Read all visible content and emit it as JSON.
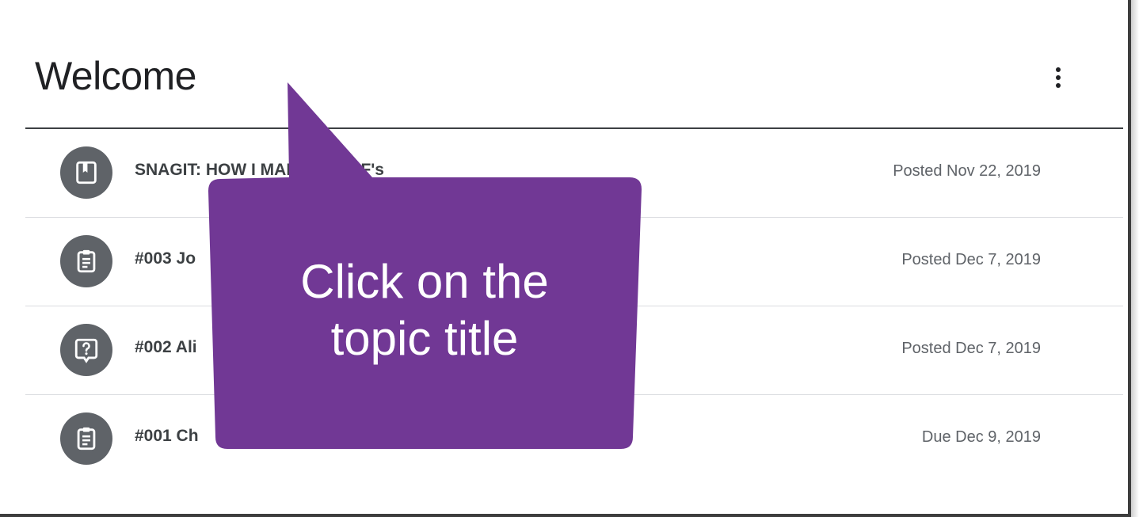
{
  "topic": {
    "title": "Welcome",
    "more_icon": "more-vert-icon"
  },
  "items": [
    {
      "icon": "book-icon",
      "title": "SNAGIT: HOW I MADE MY GIF's",
      "date": "Posted Nov 22, 2019"
    },
    {
      "icon": "assignment-icon",
      "title": "#003 Jo",
      "date": "Posted Dec 7, 2019"
    },
    {
      "icon": "question-icon",
      "title": "#002 Ali",
      "date": "Posted Dec 7, 2019"
    },
    {
      "icon": "assignment-icon",
      "title": "#001 Ch",
      "date": "Due Dec 9, 2019"
    }
  ],
  "callout": {
    "line1": "Click on the",
    "line2": "topic title",
    "color": "#713895"
  }
}
